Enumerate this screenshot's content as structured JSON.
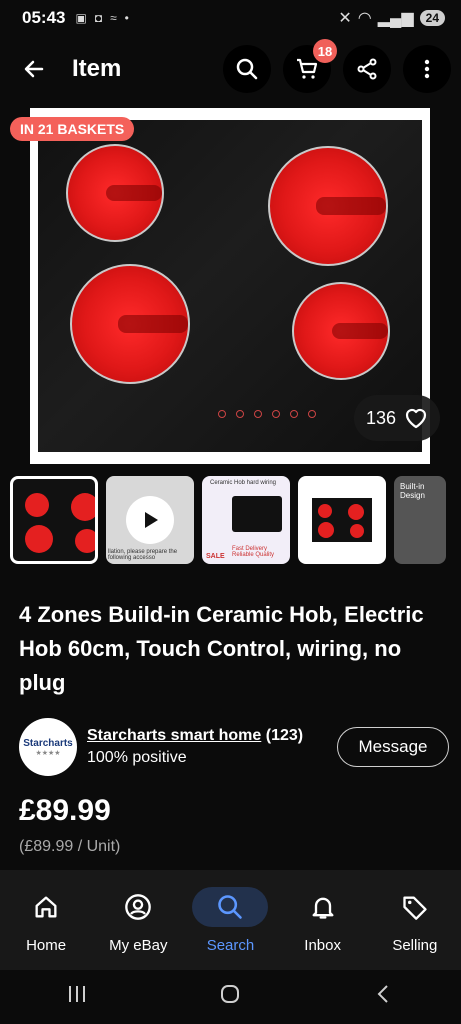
{
  "status_bar": {
    "time": "05:43",
    "battery": "24"
  },
  "top_bar": {
    "title": "Item",
    "cart_count": "18"
  },
  "main_image": {
    "basket_badge": "IN 21 BASKETS",
    "likes": "136"
  },
  "thumbnails": {
    "video_caption": "llation, please prepare the following accesso",
    "t3_title": "Ceramic Hob hard wiring",
    "t3_sale": "SALE",
    "t3_note": "Fast Delivery Reliable Quality",
    "t5_title": "Built-in Design"
  },
  "product": {
    "title": "4 Zones Build-in Ceramic Hob, Electric Hob 60cm, Touch Control, wiring, no plug",
    "price": "£89.99",
    "unit_price": "(£89.99 / Unit)"
  },
  "seller": {
    "logo_text": "Starcharts",
    "name": "Starcharts smart home",
    "feedback_count": "(123)",
    "positive": "100% positive",
    "message_label": "Message"
  },
  "bottom_nav": {
    "items": [
      {
        "label": "Home",
        "icon": "home-icon"
      },
      {
        "label": "My eBay",
        "icon": "user-icon"
      },
      {
        "label": "Search",
        "icon": "search-icon"
      },
      {
        "label": "Inbox",
        "icon": "bell-icon"
      },
      {
        "label": "Selling",
        "icon": "tag-icon"
      }
    ],
    "active": "Search"
  },
  "colors": {
    "accent": "#5c97ff",
    "badge": "#f4615a"
  }
}
